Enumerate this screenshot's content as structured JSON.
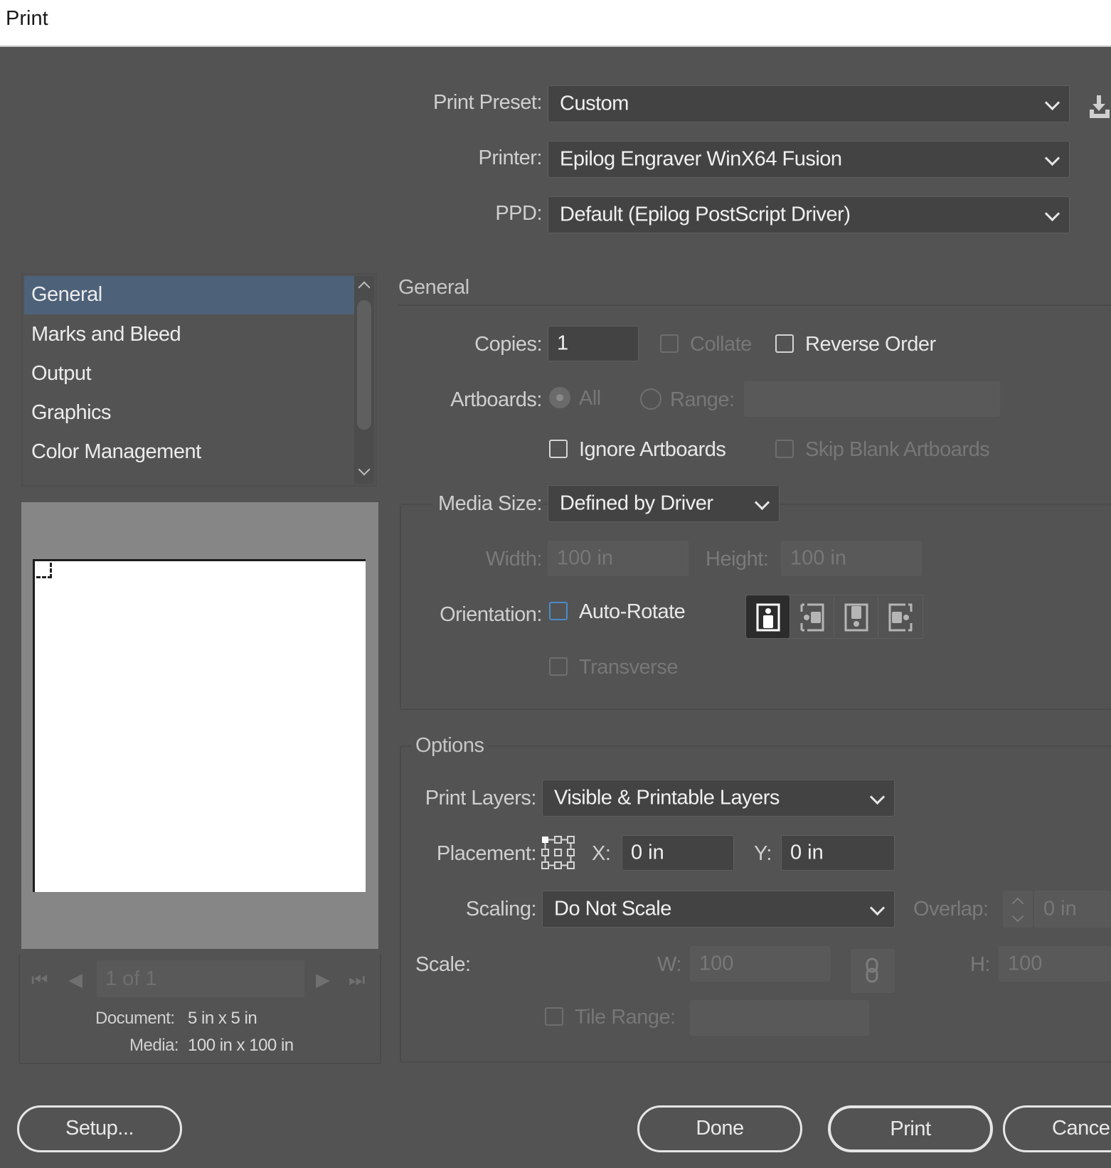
{
  "window": {
    "title": "Print"
  },
  "header": {
    "print_preset": {
      "label": "Print Preset:",
      "value": "Custom"
    },
    "printer": {
      "label": "Printer:",
      "value": "Epilog Engraver WinX64 Fusion"
    },
    "ppd": {
      "label": "PPD:",
      "value": "Default (Epilog PostScript Driver)"
    },
    "save_preset_icon": "download-icon"
  },
  "sidebar": {
    "items": [
      {
        "label": "General",
        "selected": true
      },
      {
        "label": "Marks and Bleed",
        "selected": false
      },
      {
        "label": "Output",
        "selected": false
      },
      {
        "label": "Graphics",
        "selected": false
      },
      {
        "label": "Color Management",
        "selected": false
      }
    ]
  },
  "preview": {
    "pager": {
      "value": "1 of 1"
    },
    "document_label": "Document:",
    "document_value": "5 in x 5 in",
    "media_label": "Media:",
    "media_value": "100 in x 100 in"
  },
  "general": {
    "heading": "General",
    "copies": {
      "label": "Copies:",
      "value": "1"
    },
    "collate": {
      "label": "Collate",
      "checked": false,
      "disabled": true
    },
    "reverse_order": {
      "label": "Reverse Order",
      "checked": false
    },
    "artboards": {
      "label": "Artboards:",
      "all_label": "All",
      "range_label": "Range:",
      "range_value": ""
    },
    "ignore_artboards": {
      "label": "Ignore Artboards",
      "checked": false
    },
    "skip_blank": {
      "label": "Skip Blank Artboards",
      "checked": false,
      "disabled": true
    },
    "media_size": {
      "label": "Media Size:",
      "value": "Defined by Driver"
    },
    "width": {
      "label": "Width:",
      "value": "100 in"
    },
    "height": {
      "label": "Height:",
      "value": "100 in"
    },
    "orientation": {
      "label": "Orientation:",
      "auto_rotate_label": "Auto-Rotate",
      "auto_rotate_checked": false,
      "selected": "portrait"
    },
    "transverse": {
      "label": "Transverse",
      "checked": false,
      "disabled": true
    }
  },
  "options": {
    "heading": "Options",
    "print_layers": {
      "label": "Print Layers:",
      "value": "Visible & Printable Layers"
    },
    "placement": {
      "label": "Placement:",
      "x_label": "X:",
      "x_value": "0 in",
      "y_label": "Y:",
      "y_value": "0 in"
    },
    "scaling": {
      "label": "Scaling:",
      "value": "Do Not Scale"
    },
    "overlap": {
      "label": "Overlap:",
      "value": "0 in"
    },
    "scale": {
      "label": "Scale:",
      "w_label": "W:",
      "w_value": "100",
      "h_label": "H:",
      "h_value": "100"
    },
    "tile_range": {
      "label": "Tile Range:",
      "value": ""
    }
  },
  "footer": {
    "setup": "Setup...",
    "done": "Done",
    "print": "Print",
    "cancel": "Cancel"
  }
}
